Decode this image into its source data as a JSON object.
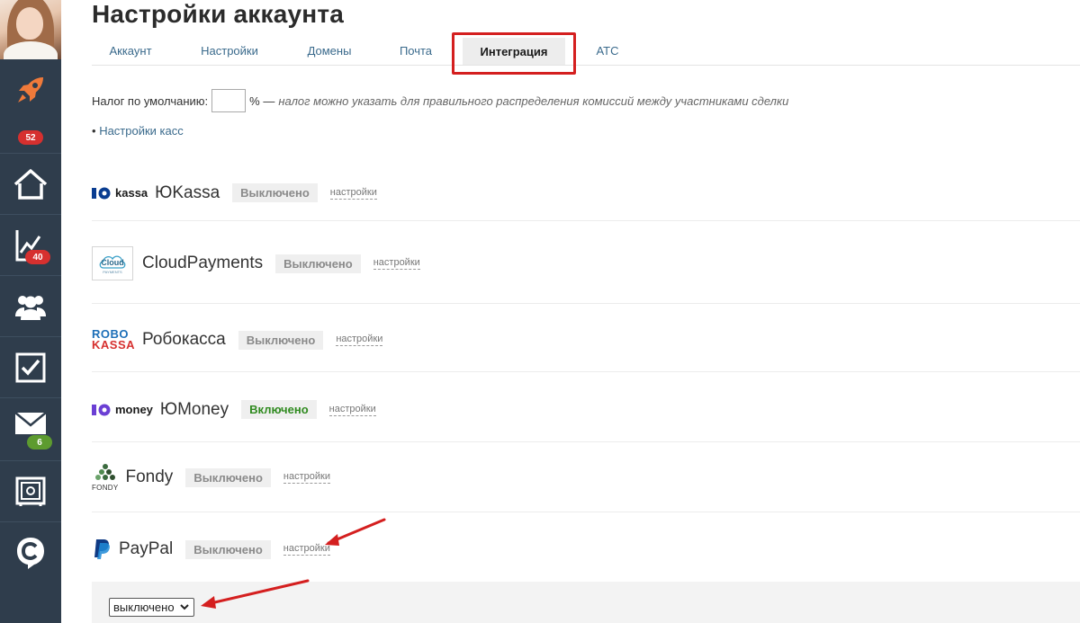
{
  "sidebar": {
    "items": [
      {
        "icon": "rocket-icon",
        "badge": "52"
      },
      {
        "icon": "home-icon"
      },
      {
        "icon": "chart-icon",
        "badge": "40"
      },
      {
        "icon": "users-icon"
      },
      {
        "icon": "checkbox-icon"
      },
      {
        "icon": "mail-icon",
        "badge": "6"
      },
      {
        "icon": "safe-icon"
      },
      {
        "icon": "c-logo-icon"
      }
    ]
  },
  "header": {
    "title": "Настройки аккаунта"
  },
  "tabs": [
    {
      "label": "Аккаунт"
    },
    {
      "label": "Настройки"
    },
    {
      "label": "Домены"
    },
    {
      "label": "Почта"
    },
    {
      "label": "Интеграция"
    },
    {
      "label": "АТС"
    }
  ],
  "tax": {
    "label": "Налог по умолчанию:",
    "value": "",
    "unit": "% —",
    "note": "налог можно указать для правильного распределения комиссий между участниками сделки"
  },
  "kassa_link": {
    "bullet": "•",
    "label": "Настройки касс"
  },
  "providers": [
    {
      "logo_text": "kassa",
      "name": "ЮKassa",
      "status": "Выключено",
      "settings": "настройки"
    },
    {
      "logo_text": "Cloud",
      "logo_sub": "PAYMENTS",
      "name": "CloudPayments",
      "status": "Выключено",
      "settings": "настройки"
    },
    {
      "logo_text_1": "ROBO",
      "logo_text_2": "KASSA",
      "name": "Робокасса",
      "status": "Выключено",
      "settings": "настройки"
    },
    {
      "logo_text": "money",
      "name": "ЮMoney",
      "status": "Включено",
      "settings": "настройки"
    },
    {
      "logo_text": "FONDY",
      "name": "Fondy",
      "status": "Выключено",
      "settings": "настройки"
    },
    {
      "name": "PayPal",
      "status": "Выключено",
      "settings": "настройки"
    }
  ],
  "paypal_select": {
    "value": "выключено"
  },
  "colors": {
    "sidebar": "#2f3d4c",
    "link": "#3a6a8c",
    "highlight": "#d41f1f",
    "enabled": "#2f8a1f",
    "badge_red": "#d6302f",
    "badge_green": "#5d9b2f"
  }
}
